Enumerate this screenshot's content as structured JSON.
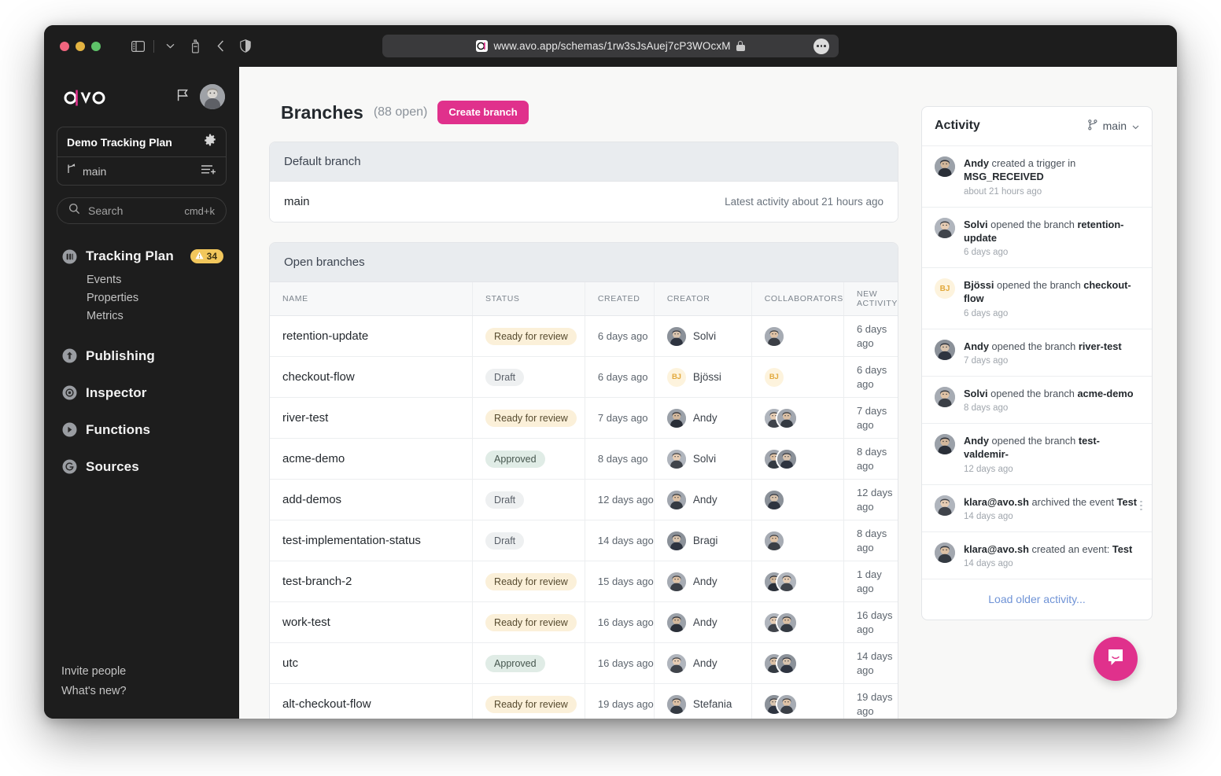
{
  "browser": {
    "url": "www.avo.app/schemas/1rw3sJsAuej7cP3WOcxM",
    "favicon_letter": "a",
    "traffic_lights": [
      "close",
      "minimize",
      "zoom"
    ],
    "toolbar_icons": [
      "sidebar-toggle-icon",
      "chevron-down-icon",
      "content-blocker-icon",
      "back-arrow-icon",
      "shield-icon"
    ],
    "page_menu_icon": "more-dots-icon"
  },
  "sidebar": {
    "logo": "avo",
    "flag_icon": "flag-icon",
    "avatar": "user-avatar",
    "workspace": {
      "name": "Demo Tracking Plan",
      "settings_icon": "gear-icon",
      "branch": "main",
      "branch_icon": "branch-icon",
      "list_add_icon": "list-add-icon"
    },
    "search": {
      "placeholder": "Search",
      "shortcut": "cmd+k",
      "icon": "search-icon"
    },
    "tracking_plan": {
      "label": "Tracking Plan",
      "icon": "tracking-plan-icon",
      "badge_count": "34",
      "badge_icon": "warning-icon",
      "children": [
        {
          "label": "Events"
        },
        {
          "label": "Properties"
        },
        {
          "label": "Metrics"
        }
      ]
    },
    "nav_items": [
      {
        "label": "Publishing",
        "icon": "publish-icon"
      },
      {
        "label": "Inspector",
        "icon": "inspector-icon"
      },
      {
        "label": "Functions",
        "icon": "functions-icon"
      },
      {
        "label": "Sources",
        "icon": "sources-icon"
      }
    ],
    "footer_links": [
      {
        "label": "Invite people"
      },
      {
        "label": "What's new?"
      }
    ]
  },
  "main": {
    "title": "Branches",
    "subtitle": "(88 open)",
    "create_button": "Create branch",
    "default_branch_card": {
      "header": "Default branch",
      "name": "main",
      "meta": "Latest activity about 21 hours ago"
    },
    "open_branches_card": {
      "header": "Open branches",
      "columns": [
        "NAME",
        "STATUS",
        "CREATED",
        "CREATOR",
        "COLLABORATORS",
        "NEW ACTIVITY"
      ],
      "rows": [
        {
          "name": "retention-update",
          "status": "Ready for review",
          "status_kind": "review",
          "created": "6 days ago",
          "creator": "Solvi",
          "creator_avatar": "photo",
          "collaborators": [
            "photo"
          ],
          "new_activity": "6 days ago"
        },
        {
          "name": "checkout-flow",
          "status": "Draft",
          "status_kind": "draft",
          "created": "6 days ago",
          "creator": "Bjössi",
          "creator_avatar": "BJ",
          "collaborators": [
            "BJ"
          ],
          "new_activity": "6 days ago"
        },
        {
          "name": "river-test",
          "status": "Ready for review",
          "status_kind": "review",
          "created": "7 days ago",
          "creator": "Andy",
          "creator_avatar": "photo",
          "collaborators": [
            "photo",
            "photo"
          ],
          "new_activity": "7 days ago"
        },
        {
          "name": "acme-demo",
          "status": "Approved",
          "status_kind": "approved",
          "created": "8 days ago",
          "creator": "Solvi",
          "creator_avatar": "photo",
          "collaborators": [
            "photo",
            "photo"
          ],
          "new_activity": "8 days ago"
        },
        {
          "name": "add-demos",
          "status": "Draft",
          "status_kind": "draft",
          "created": "12 days ago",
          "creator": "Andy",
          "creator_avatar": "photo",
          "collaborators": [
            "photo"
          ],
          "new_activity": "12 days ago"
        },
        {
          "name": "test-implementation-status",
          "status": "Draft",
          "status_kind": "draft",
          "created": "14 days ago",
          "creator": "Bragi",
          "creator_avatar": "photo",
          "collaborators": [
            "photo"
          ],
          "new_activity": "8 days ago"
        },
        {
          "name": "test-branch-2",
          "status": "Ready for review",
          "status_kind": "review",
          "created": "15 days ago",
          "creator": "Andy",
          "creator_avatar": "photo",
          "collaborators": [
            "photo",
            "photo"
          ],
          "new_activity": "1 day ago"
        },
        {
          "name": "work-test",
          "status": "Ready for review",
          "status_kind": "review",
          "created": "16 days ago",
          "creator": "Andy",
          "creator_avatar": "photo",
          "collaborators": [
            "photo",
            "photo"
          ],
          "new_activity": "16 days ago"
        },
        {
          "name": "utc",
          "status": "Approved",
          "status_kind": "approved",
          "created": "16 days ago",
          "creator": "Andy",
          "creator_avatar": "photo",
          "collaborators": [
            "photo",
            "photo"
          ],
          "new_activity": "14 days ago"
        },
        {
          "name": "alt-checkout-flow",
          "status": "Ready for review",
          "status_kind": "review",
          "created": "19 days ago",
          "creator": "Stefania",
          "creator_avatar": "photo",
          "collaborators": [
            "photo",
            "photo"
          ],
          "new_activity": "19 days ago"
        }
      ]
    }
  },
  "activity": {
    "title": "Activity",
    "branch_label": "main",
    "branch_icon": "branch-icon",
    "chevron_icon": "chevron-down-icon",
    "items": [
      {
        "actor": "Andy",
        "action": " created a trigger in ",
        "target": "MSG_RECEIVED",
        "time": "about 21 hours ago",
        "avatar": "photo",
        "kebab": false
      },
      {
        "actor": "Solvi",
        "action": " opened the branch ",
        "target": "retention-update",
        "time": "6 days ago",
        "avatar": "photo",
        "kebab": false
      },
      {
        "actor": "Bjössi",
        "action": " opened the branch ",
        "target": "checkout-flow",
        "time": "6 days ago",
        "avatar": "BJ",
        "kebab": false
      },
      {
        "actor": "Andy",
        "action": " opened the branch ",
        "target": "river-test",
        "time": "7 days ago",
        "avatar": "photo",
        "kebab": false
      },
      {
        "actor": "Solvi",
        "action": " opened the branch ",
        "target": "acme-demo",
        "time": "8 days ago",
        "avatar": "photo",
        "kebab": false
      },
      {
        "actor": "Andy",
        "action": " opened the branch ",
        "target": "test-valdemir-",
        "time": "12 days ago",
        "avatar": "photo",
        "kebab": false
      },
      {
        "actor": "klara@avo.sh",
        "action": " archived the event ",
        "target": "Test",
        "time": "14 days ago",
        "avatar": "photo",
        "kebab": true
      },
      {
        "actor": "klara@avo.sh",
        "action": " created an event: ",
        "target": "Test",
        "time": "14 days ago",
        "avatar": "photo",
        "kebab": false
      }
    ],
    "load_more": "Load older activity..."
  },
  "intercom": {
    "icon": "chat-bubble-icon"
  },
  "colors": {
    "accent": "#e0318c",
    "sidebar_bg": "#1d1d1d",
    "page_bg": "#f8f8f7",
    "link": "#6f93d6",
    "warning": "#f2c75c"
  }
}
